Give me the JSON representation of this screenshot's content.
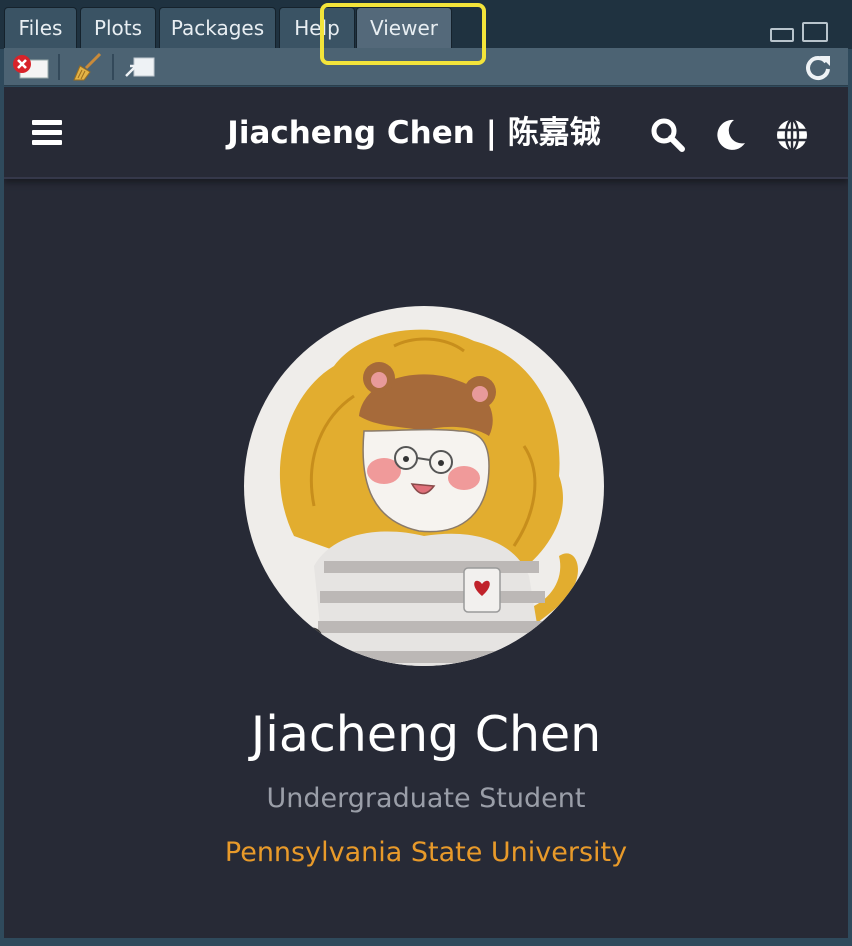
{
  "pane_tabs": [
    {
      "label": "Files",
      "active": false
    },
    {
      "label": "Plots",
      "active": false
    },
    {
      "label": "Packages",
      "active": false
    },
    {
      "label": "Help",
      "active": false
    },
    {
      "label": "Viewer",
      "active": true
    }
  ],
  "toolbar": {
    "icons": [
      "clear-viewer-icon",
      "broom-icon",
      "show-in-window-icon",
      "refresh-icon"
    ]
  },
  "site": {
    "title": "Jiacheng Chen | 陈嘉铖",
    "nav_icons": [
      "menu-icon",
      "search-icon",
      "dark-mode-moon-icon",
      "language-globe-icon"
    ]
  },
  "profile": {
    "name": "Jiacheng Chen",
    "role": "Undergraduate Student",
    "organization": "Pennsylvania State University"
  },
  "colors": {
    "background": "#272a36",
    "accent": "#e89a2a",
    "highlight": "#f3e43a"
  }
}
